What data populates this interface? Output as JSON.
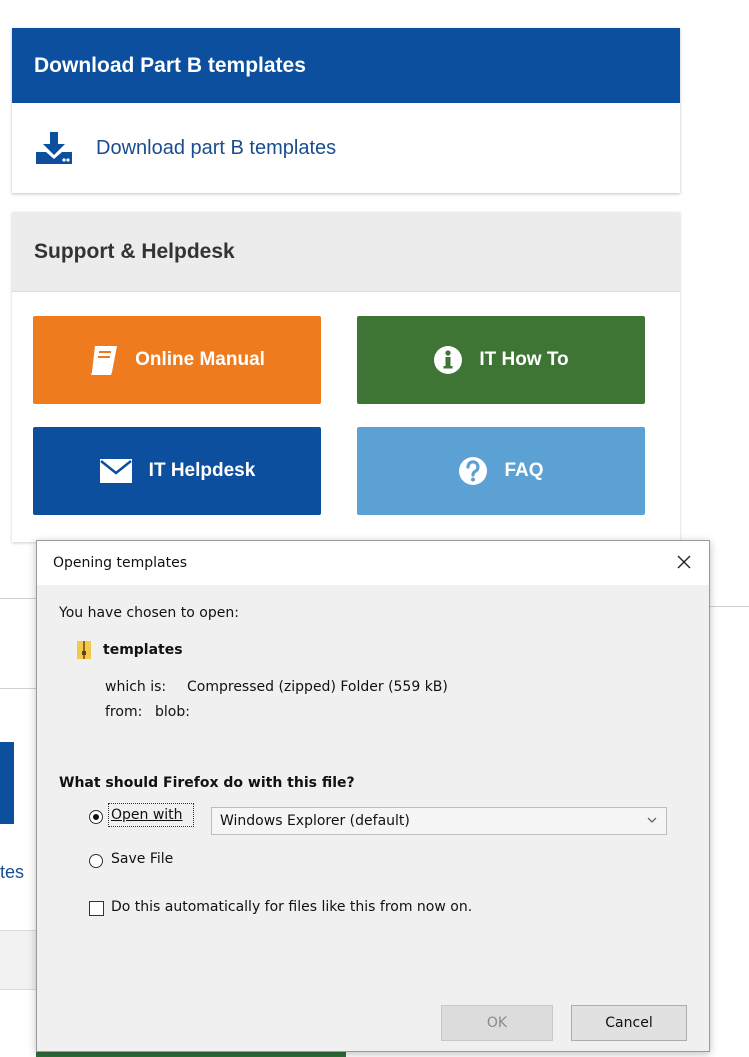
{
  "download_card": {
    "header": "Download Part B templates",
    "link_label": "Download part B templates",
    "icon": "download-icon"
  },
  "support_card": {
    "header": "Support & Helpdesk",
    "tiles": [
      {
        "label": "Online Manual",
        "icon": "book-icon",
        "color": "#ef7b1f"
      },
      {
        "label": "IT How To",
        "icon": "info-icon",
        "color": "#3f7534"
      },
      {
        "label": "IT Helpdesk",
        "icon": "envelope-icon",
        "color": "#0b4f9e"
      },
      {
        "label": "FAQ",
        "icon": "question-icon",
        "color": "#5ba1d3"
      }
    ]
  },
  "background": {
    "text_fragment": "tes"
  },
  "dialog": {
    "title": "Opening templates",
    "chosen_label": "You have chosen to open:",
    "file_name": "templates",
    "which_is_label": "which is:",
    "which_is_value": "Compressed (zipped) Folder (559 kB)",
    "from_label": "from:",
    "from_value": "blob:",
    "question": "What should Firefox do with this file?",
    "open_with_label": "Open with",
    "open_with_value": "Windows Explorer (default)",
    "save_file_label": "Save File",
    "auto_label": "Do this automatically for files like this from now on.",
    "ok_label": "OK",
    "cancel_label": "Cancel",
    "selected_option": "open_with"
  },
  "colors": {
    "brand_blue": "#0b4f9e",
    "orange": "#ef7b1f",
    "green": "#3f7534",
    "light_blue": "#5ba1d3"
  }
}
